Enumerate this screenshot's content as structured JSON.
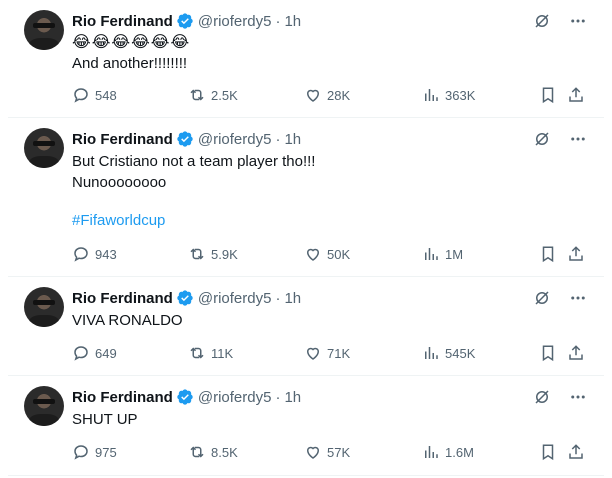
{
  "tweets": [
    {
      "name": "Rio Ferdinand",
      "handle": "@rioferdy5",
      "dot": "·",
      "time": "1h",
      "emojis": "😂😂😂😂😂😂",
      "lines": [
        "And another!!!!!!!!"
      ],
      "hashtag": "",
      "replies": "548",
      "reposts": "2.5K",
      "likes": "28K",
      "views": "363K"
    },
    {
      "name": "Rio Ferdinand",
      "handle": "@rioferdy5",
      "dot": "·",
      "time": "1h",
      "emojis": "",
      "lines": [
        "But Cristiano not a team player tho!!!",
        "Nunoooooooo"
      ],
      "hashtag": "#Fifaworldcup",
      "replies": "943",
      "reposts": "5.9K",
      "likes": "50K",
      "views": "1M"
    },
    {
      "name": "Rio Ferdinand",
      "handle": "@rioferdy5",
      "dot": "·",
      "time": "1h",
      "emojis": "",
      "lines": [
        "VIVA RONALDO"
      ],
      "hashtag": "",
      "replies": "649",
      "reposts": "11K",
      "likes": "71K",
      "views": "545K"
    },
    {
      "name": "Rio Ferdinand",
      "handle": "@rioferdy5",
      "dot": "·",
      "time": "1h",
      "emojis": "",
      "lines": [
        "SHUT UP"
      ],
      "hashtag": "",
      "replies": "975",
      "reposts": "8.5K",
      "likes": "57K",
      "views": "1.6M"
    }
  ],
  "colors": {
    "verified": "#1d9bf0",
    "muted": "#536471",
    "hashtag": "#1d9bf0",
    "divider": "#eff3f4"
  },
  "icons": [
    "grok-icon",
    "more-icon",
    "reply-icon",
    "repost-icon",
    "like-icon",
    "views-icon",
    "bookmark-icon",
    "share-icon"
  ]
}
